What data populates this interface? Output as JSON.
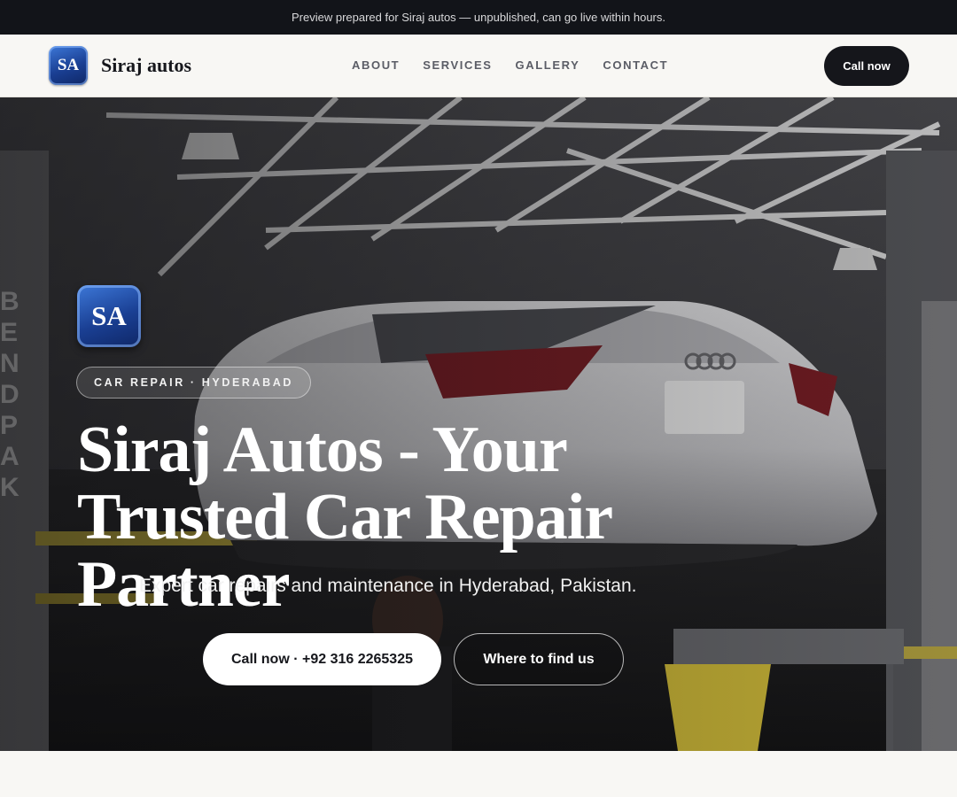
{
  "topbar": {
    "text": "Preview prepared for Siraj autos — unpublished, can go live within hours."
  },
  "header": {
    "logo_initials": "SA",
    "brand": "Siraj autos",
    "nav": [
      {
        "label": "ABOUT"
      },
      {
        "label": "SERVICES"
      },
      {
        "label": "GALLERY"
      },
      {
        "label": "CONTACT"
      }
    ],
    "cta": "Call now"
  },
  "hero": {
    "logo_initials": "SA",
    "pill": "CAR REPAIR · HYDERABAD",
    "title": "Siraj Autos - Your Trusted Car Repair Partner",
    "subtitle": "Expert car repairs and maintenance in Hyderabad, Pakistan.",
    "primary_button": "Call now · +92 316 2265325",
    "secondary_button": "Where to find us",
    "image": "garage-car-lift-photo"
  },
  "colors": {
    "dark": "#121419",
    "page_bg": "#f8f7f4",
    "logo_blue": "#1a3f93",
    "cta_dark": "#15161b"
  }
}
